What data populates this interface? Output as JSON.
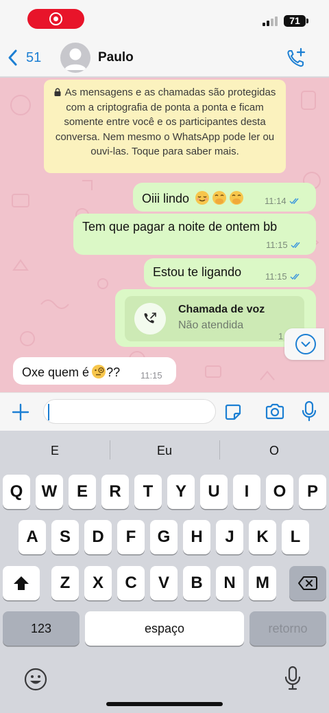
{
  "status_bar": {
    "battery": "71"
  },
  "header": {
    "back_count": "51",
    "contact_name": "Paulo"
  },
  "encryption_notice": "As mensagens e as chamadas são protegidas com a criptografia de ponta a ponta e ficam somente entre você e os participantes desta conversa. Nem mesmo o WhatsApp pode ler ou ouvi-las. Toque para saber mais.",
  "messages": [
    {
      "direction": "out",
      "text": "Oiii lindo",
      "emojis": [
        "relieved-face",
        "face-with-hand-over-mouth",
        "face-with-hand-over-mouth"
      ],
      "time": "11:14",
      "status": "read"
    },
    {
      "direction": "out",
      "text": "Tem que pagar a noite de ontem bb",
      "time": "11:15",
      "status": "read"
    },
    {
      "direction": "out",
      "text": "Estou te ligando",
      "time": "11:15",
      "status": "read"
    },
    {
      "direction": "out",
      "type": "call",
      "call_title": "Chamada de voz",
      "call_status": "Não atendida",
      "time": "1"
    },
    {
      "direction": "in",
      "text": "Oxe quem é",
      "text_after": "??",
      "emojis": [
        "face-with-monocle"
      ],
      "time": "11:15"
    }
  ],
  "input": {
    "value": "",
    "placeholder": ""
  },
  "keyboard": {
    "suggestions": [
      "E",
      "Eu",
      "O"
    ],
    "row1": [
      "Q",
      "W",
      "E",
      "R",
      "T",
      "Y",
      "U",
      "I",
      "O",
      "P"
    ],
    "row2": [
      "A",
      "S",
      "D",
      "F",
      "G",
      "H",
      "J",
      "K",
      "L"
    ],
    "row3": [
      "Z",
      "X",
      "C",
      "V",
      "B",
      "N",
      "M"
    ],
    "numbers_key": "123",
    "space_key": "espaço",
    "return_key": "retorno"
  },
  "colors": {
    "accent": "#1c7fd3",
    "outgoing_bubble": "#dbf8c6",
    "incoming_bubble": "#ffffff",
    "wallpaper": "#f1c3cc",
    "notice": "#fbf2be",
    "recording": "#e8142a"
  }
}
